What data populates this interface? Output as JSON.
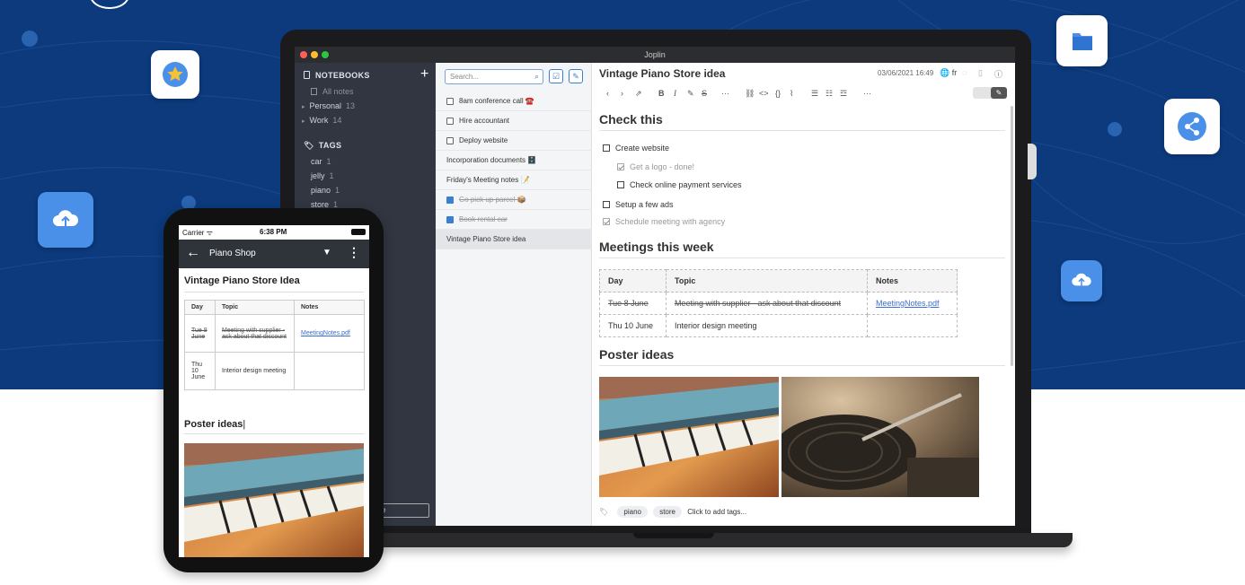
{
  "window": {
    "title": "Joplin"
  },
  "sidebar": {
    "notebooks_header": "NOTEBOOKS",
    "all_notes": "All notes",
    "notebooks": [
      {
        "label": "Personal",
        "count": "13"
      },
      {
        "label": "Work",
        "count": "14"
      }
    ],
    "tags_header": "TAGS",
    "tags": [
      {
        "label": "car",
        "count": "1"
      },
      {
        "label": "jelly",
        "count": "1"
      },
      {
        "label": "piano",
        "count": "1"
      },
      {
        "label": "store",
        "count": "1"
      }
    ],
    "partial_button": "se"
  },
  "notelist": {
    "search_placeholder": "Search...",
    "items": [
      {
        "label": "8am conference call ☎️"
      },
      {
        "label": "Hire accountant"
      },
      {
        "label": "Deploy website"
      },
      {
        "label": "Incorporation documents 🗄️"
      },
      {
        "label": "Friday's Meeting notes 📝"
      },
      {
        "label": "Go pick up parcel 📦"
      },
      {
        "label": "Book rental car"
      },
      {
        "label": "Vintage Piano Store idea"
      }
    ]
  },
  "editor": {
    "title": "Vintage Piano Store idea",
    "date": "03/06/2021 16:49",
    "lang": "fr",
    "h_check": "Check this",
    "checks": [
      {
        "label": "Create website"
      },
      {
        "label": "Get a logo - done!"
      },
      {
        "label": "Check online payment services"
      },
      {
        "label": "Setup a few ads"
      },
      {
        "label": "Schedule meeting with agency"
      }
    ],
    "h_meetings": "Meetings this week",
    "table": {
      "headers": [
        "Day",
        "Topic",
        "Notes"
      ],
      "rows": [
        [
          "Tue 8 June",
          "Meeting with supplier - ask about that discount",
          "MeetingNotes.pdf"
        ],
        [
          "Thu 10 June",
          "Interior design meeting",
          ""
        ]
      ]
    },
    "h_poster": "Poster ideas",
    "tags": [
      "piano",
      "store"
    ],
    "add_tags": "Click to add tags..."
  },
  "phone": {
    "carrier": "Carrier",
    "time": "6:38 PM",
    "header_title": "Piano Shop",
    "note_title": "Vintage Piano Store Idea",
    "table": {
      "headers": [
        "Day",
        "Topic",
        "Notes"
      ],
      "rows": [
        [
          "Tue 8 June",
          "Meeting with supplier - ask about that discount",
          "MeetingNotes.pdf"
        ],
        [
          "Thu 10 June",
          "Interior design meeting",
          ""
        ]
      ]
    },
    "poster": "Poster ideas"
  },
  "colors": {
    "background": "#0c3a7c",
    "accent": "#3b7fd1",
    "sidebar": "#313640"
  }
}
